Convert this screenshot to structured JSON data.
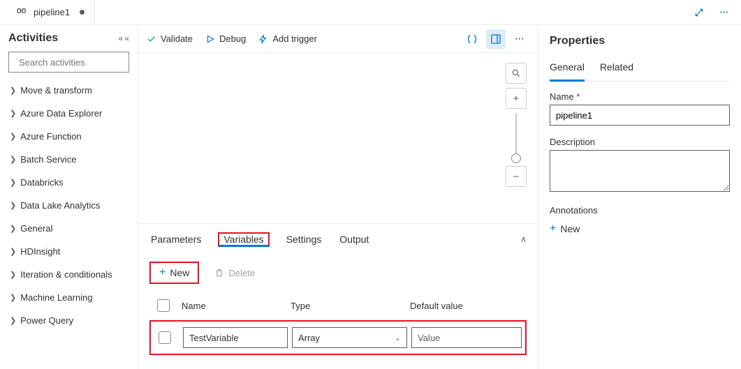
{
  "tab": {
    "title": "pipeline1"
  },
  "sidebar": {
    "title": "Activities",
    "search_placeholder": "Search activities",
    "items": [
      "Move & transform",
      "Azure Data Explorer",
      "Azure Function",
      "Batch Service",
      "Databricks",
      "Data Lake Analytics",
      "General",
      "HDInsight",
      "Iteration & conditionals",
      "Machine Learning",
      "Power Query"
    ]
  },
  "toolbar": {
    "validate": "Validate",
    "debug": "Debug",
    "add_trigger": "Add trigger"
  },
  "config": {
    "tabs": {
      "parameters": "Parameters",
      "variables": "Variables",
      "settings": "Settings",
      "output": "Output"
    },
    "new": "New",
    "delete": "Delete",
    "headers": {
      "name": "Name",
      "type": "Type",
      "default": "Default value"
    },
    "row": {
      "name": "TestVariable",
      "type": "Array",
      "default": "Value"
    }
  },
  "properties": {
    "title": "Properties",
    "tabs": {
      "general": "General",
      "related": "Related"
    },
    "name_label": "Name",
    "name_value": "pipeline1",
    "description_label": "Description",
    "description_value": "",
    "annotations_label": "Annotations",
    "new": "New"
  }
}
